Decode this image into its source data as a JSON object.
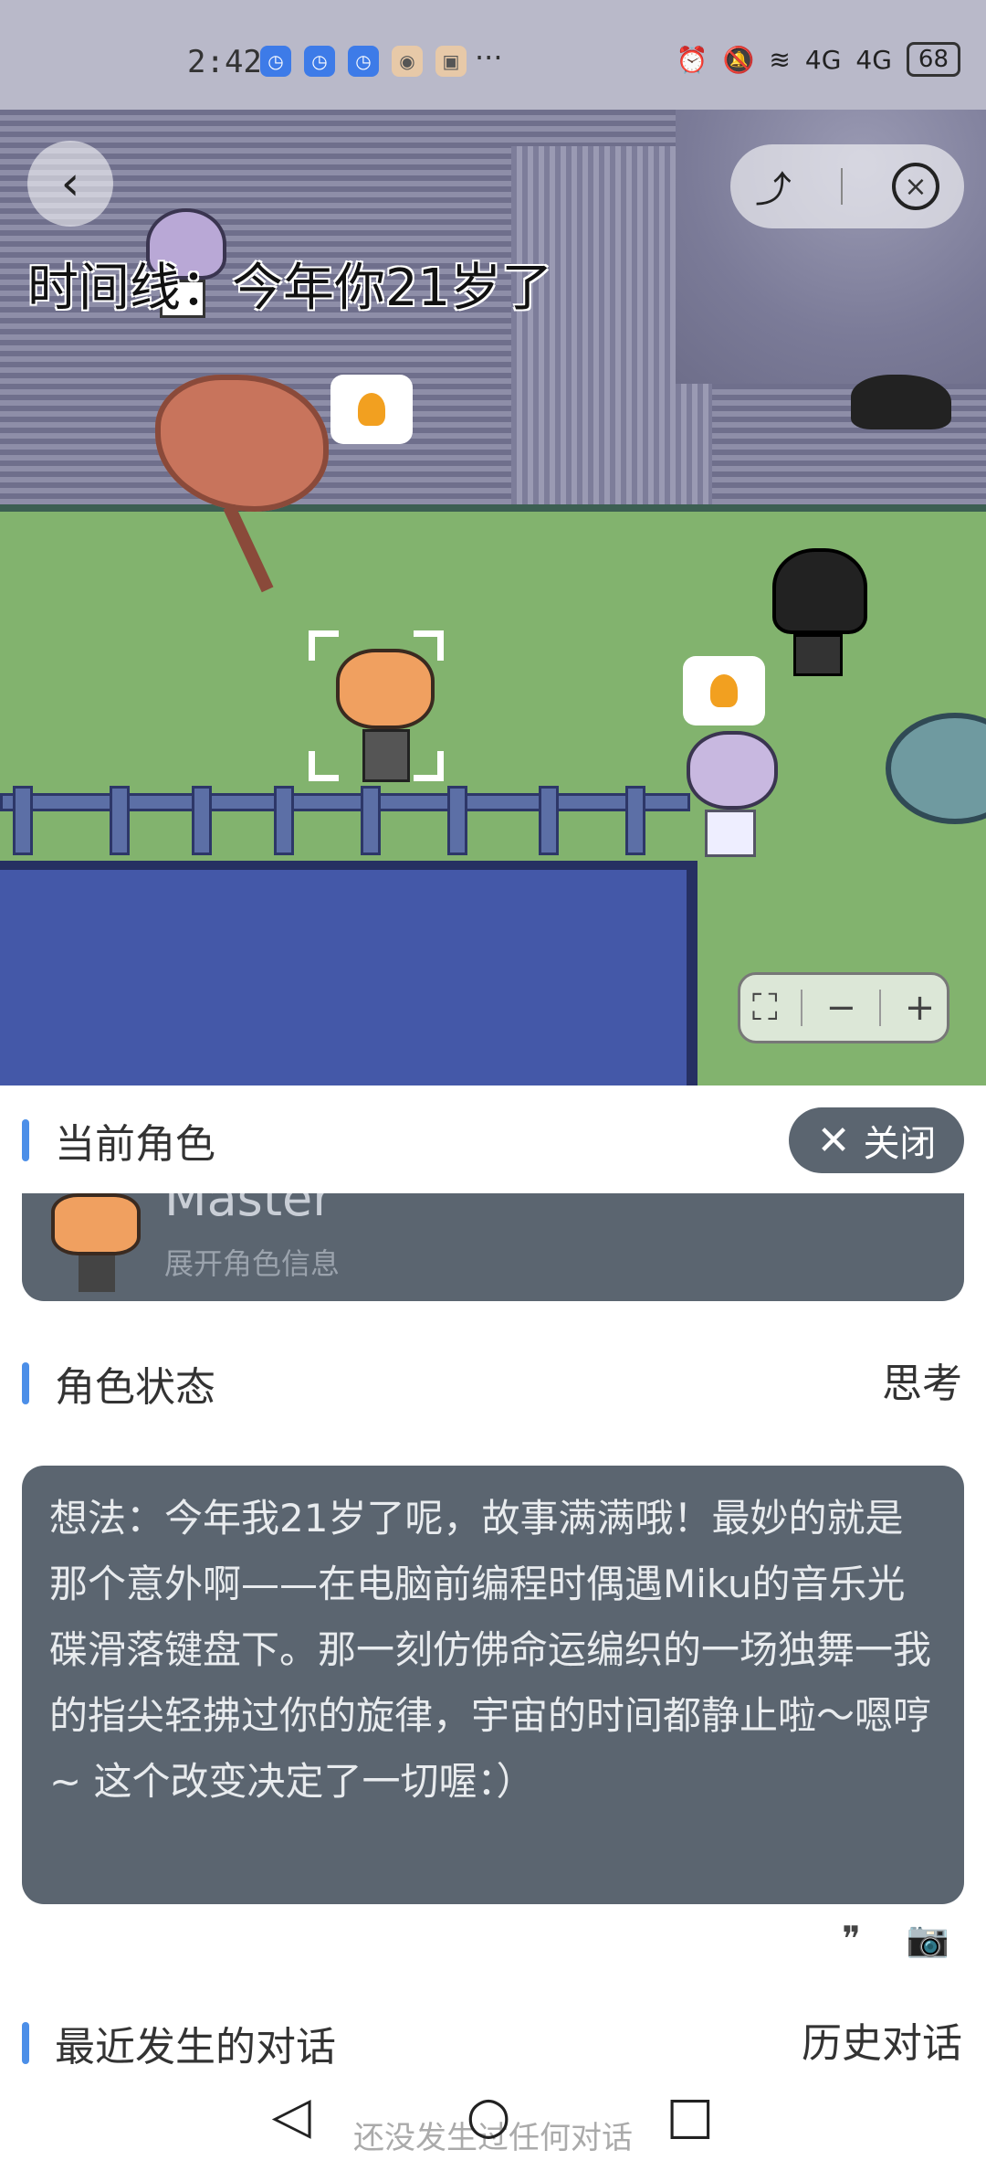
{
  "status_bar": {
    "time": "2:42",
    "app_icons": [
      "clock-icon",
      "clock-icon",
      "clock-icon",
      "app-icon",
      "app-icon"
    ],
    "overflow": "···",
    "signal_labels": [
      "4G",
      "4G"
    ],
    "battery": "68"
  },
  "scene": {
    "timeline_text": "时间线：今年你21岁了",
    "back_glyph": "‹",
    "share_glyph": "⤴",
    "close_glyph": "×",
    "zoom": {
      "fit_glyph": "⛶",
      "minus_glyph": "−",
      "plus_glyph": "+"
    }
  },
  "panel": {
    "current_role": {
      "title": "当前角色",
      "close_label": "关闭",
      "close_glyph": "✕",
      "name": "Master",
      "expand_label": "展开角色信息"
    },
    "role_status": {
      "title": "角色状态",
      "right_label": "思考",
      "thought_text": "想法：今年我21岁了呢，故事满满哦！最妙的就是那个意外啊——在电脑前编程时偶遇Miku的音乐光碟滑落键盘下。那一刻仿佛命运编织的一场独舞一我的指尖轻拂过你的旋律，宇宙的时间都静止啦～嗯哼~ 这个改变决定了一切喔：）",
      "quote_glyph": "❞",
      "camera_glyph": "📷"
    },
    "recent_dialog": {
      "title": "最近发生的对话",
      "right_label": "历史对话",
      "empty_text": "还没发生过任何对话"
    }
  },
  "navbar": {
    "back_glyph": "◁",
    "home_glyph": "○",
    "recents_glyph": "□"
  },
  "colors": {
    "accent": "#4c8fe8",
    "card": "#5b6570",
    "status_bar": "#b9b9c9"
  }
}
